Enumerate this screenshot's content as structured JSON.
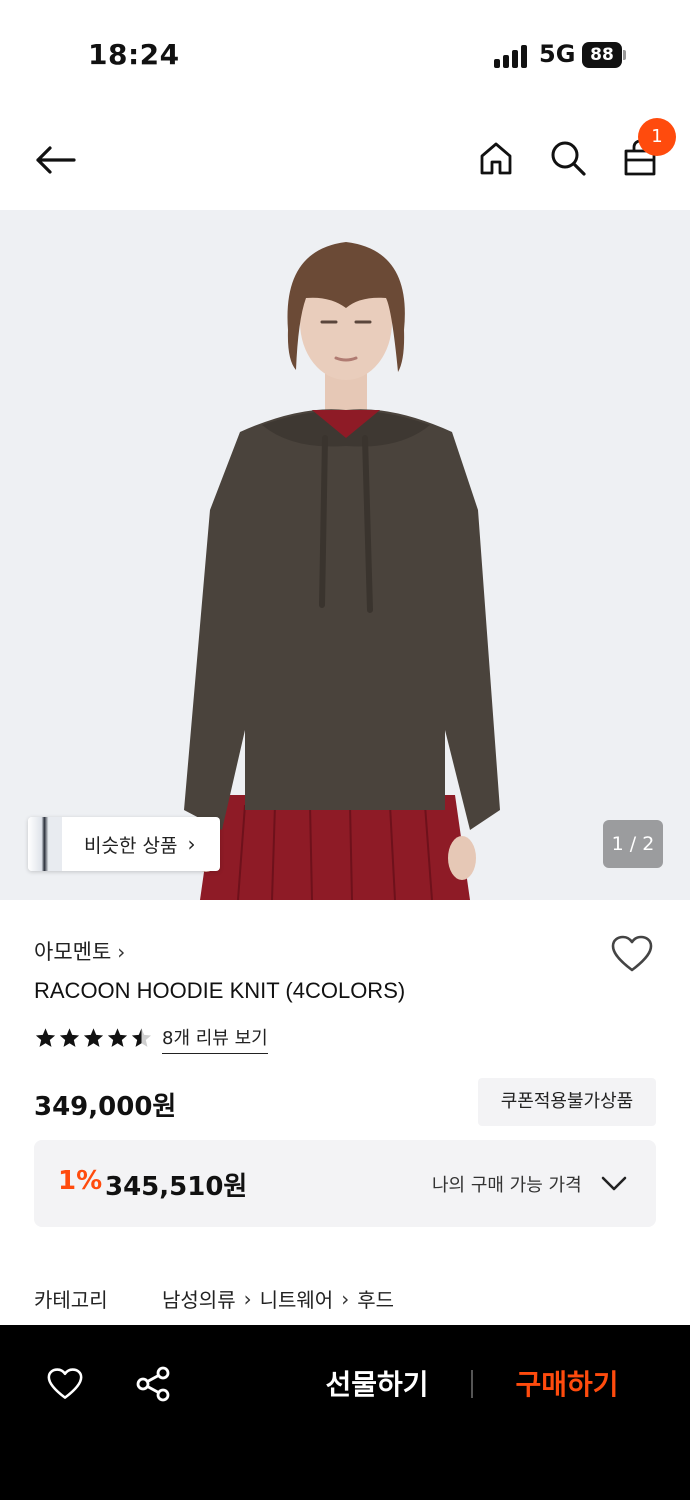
{
  "status_bar": {
    "time": "18:24",
    "network": "5G",
    "battery": "88"
  },
  "nav": {
    "cart_count": "1"
  },
  "image": {
    "similar_label": "비슷한 상품",
    "counter": "1 / 2"
  },
  "product": {
    "brand": "아모멘토",
    "title": "RACOON HOODIE KNIT (4COLORS)",
    "rating": 4.5,
    "review_link": "8개 리뷰 보기",
    "price": "349,000원",
    "coupon_badge": "쿠폰적용불가상품",
    "my_price": {
      "percent": "1%",
      "amount": "345,510원",
      "label": "나의 구매 가능 가격"
    },
    "category_label": "카테고리",
    "categories": [
      "남성의류",
      "니트웨어",
      "후드"
    ]
  },
  "bottom_bar": {
    "gift_label": "선물하기",
    "buy_label": "구매하기"
  },
  "colors": {
    "accent": "#ff4b0d",
    "bar": "#000000",
    "chip_bg": "#f3f3f5"
  }
}
